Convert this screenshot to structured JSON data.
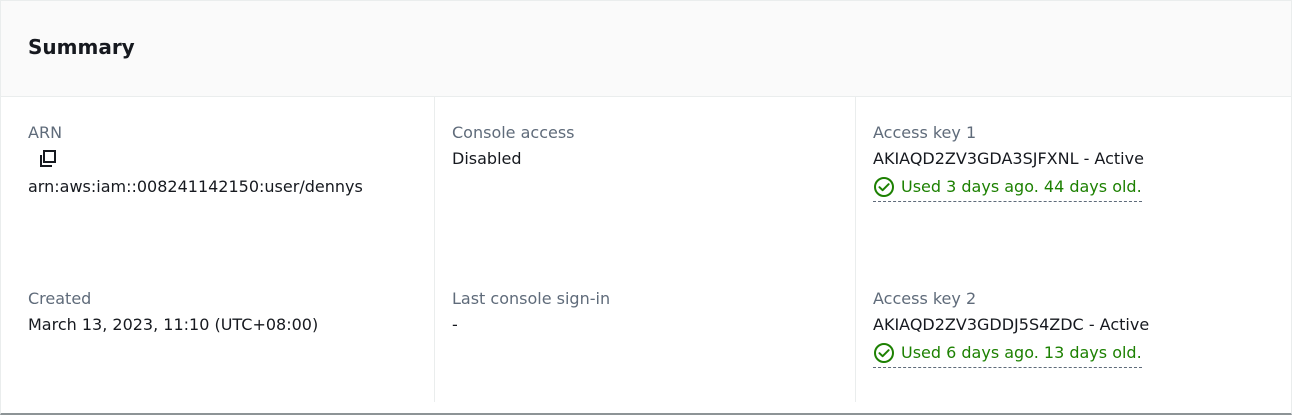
{
  "summary": {
    "title": "Summary",
    "arn": {
      "label": "ARN",
      "value": "arn:aws:iam::008241142150:user/dennys",
      "copy_icon": "copy-icon"
    },
    "created": {
      "label": "Created",
      "value": "March 13, 2023, 11:10 (UTC+08:00)"
    },
    "console_access": {
      "label": "Console access",
      "value": "Disabled"
    },
    "last_sign_in": {
      "label": "Last console sign-in",
      "value": "-"
    },
    "access_key_1": {
      "label": "Access key 1",
      "value": "AKIAQD2ZV3GDA3SJFXNL - Active",
      "status": "Used 3 days ago. 44 days old.",
      "status_icon": "check-circle-icon"
    },
    "access_key_2": {
      "label": "Access key 2",
      "value": "AKIAQD2ZV3GDDJ5S4ZDC - Active",
      "status": "Used 6 days ago. 13 days old.",
      "status_icon": "check-circle-icon"
    }
  },
  "colors": {
    "label": "#5f6b7a",
    "text": "#16191f",
    "success": "#1d8102",
    "header_bg": "#fafafa",
    "divider": "#eaeded"
  }
}
